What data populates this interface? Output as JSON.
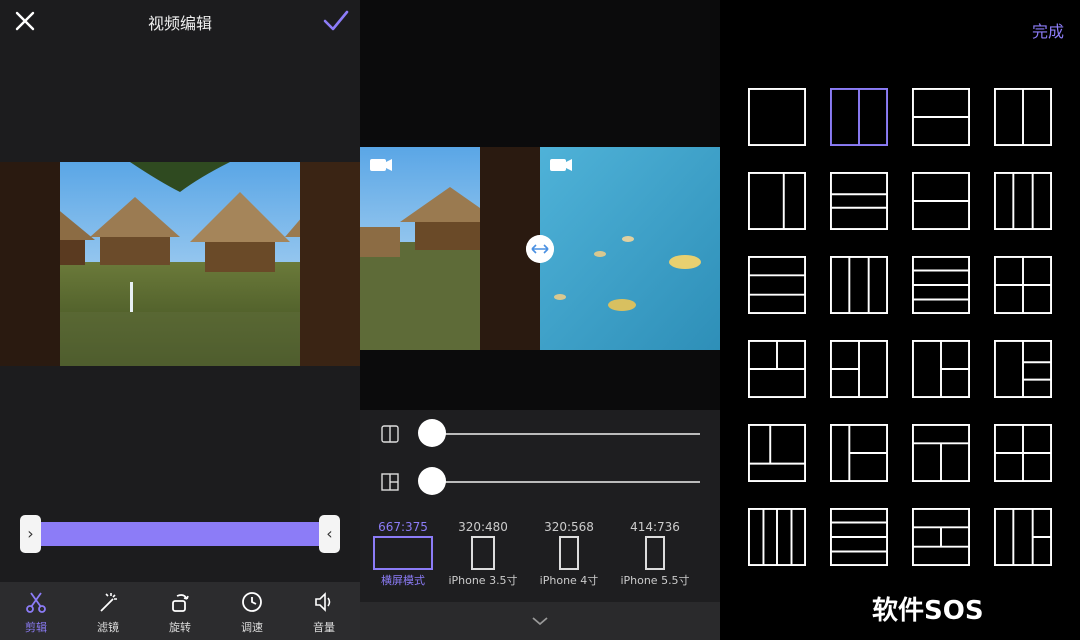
{
  "editor": {
    "title": "视频编辑",
    "toolbar": [
      {
        "label": "剪辑",
        "icon": "scissors-icon",
        "active": true
      },
      {
        "label": "滤镜",
        "icon": "magic-wand-icon",
        "active": false
      },
      {
        "label": "旋转",
        "icon": "rotate-icon",
        "active": false
      },
      {
        "label": "调速",
        "icon": "clock-icon",
        "active": false
      },
      {
        "label": "音量",
        "icon": "speaker-icon",
        "active": false
      }
    ]
  },
  "split": {
    "slider1": 0.0,
    "slider2": 0.0,
    "ratios": [
      {
        "value": "667:375",
        "label": "横屏模式",
        "active": true
      },
      {
        "value": "320:480",
        "label": "iPhone 3.5寸",
        "active": false
      },
      {
        "value": "320:568",
        "label": "iPhone 4寸",
        "active": false
      },
      {
        "value": "414:736",
        "label": "iPhone 5.5寸",
        "active": false
      }
    ]
  },
  "layouts": {
    "done": "完成",
    "selected_index": 1
  },
  "watermark": "软件SOS",
  "colors": {
    "accent": "#8c7cf7",
    "panel": "#1c1c1e"
  }
}
